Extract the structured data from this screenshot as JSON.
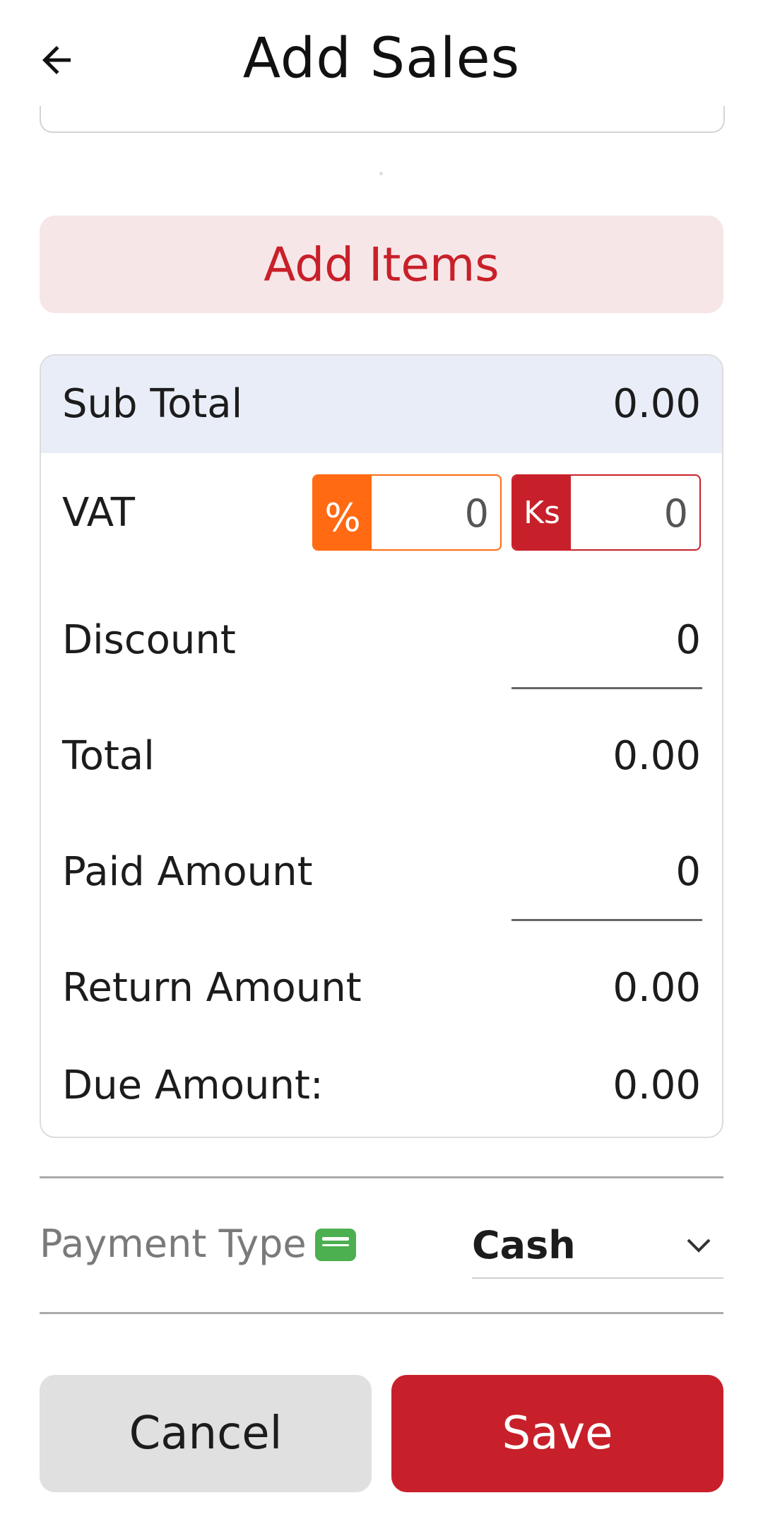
{
  "header": {
    "title": "Add Sales",
    "back_icon": "arrow-left-icon"
  },
  "add_items_label": "Add Items",
  "summary": {
    "subtotal_label": "Sub Total",
    "subtotal_value": "0.00",
    "vat_label": "VAT",
    "vat_percent_symbol": "%",
    "vat_percent_value": "0",
    "vat_ks_symbol": "Ks",
    "vat_ks_value": "0",
    "discount_label": "Discount",
    "discount_value": "0",
    "total_label": "Total",
    "total_value": "0.00",
    "paid_label": "Paid Amount",
    "paid_value": "0",
    "return_label": "Return Amount",
    "return_value": "0.00",
    "due_label": "Due Amount:",
    "due_value": "0.00"
  },
  "payment": {
    "label": "Payment Type",
    "icon": "wallet-icon",
    "selected": "Cash"
  },
  "actions": {
    "cancel_label": "Cancel",
    "save_label": "Save"
  },
  "colors": {
    "primary_red": "#c8202a",
    "orange": "#ff6a13",
    "light_pink": "#f7e6e7",
    "subtotal_bg": "#e9edf7",
    "wallet_green": "#4caf50"
  }
}
